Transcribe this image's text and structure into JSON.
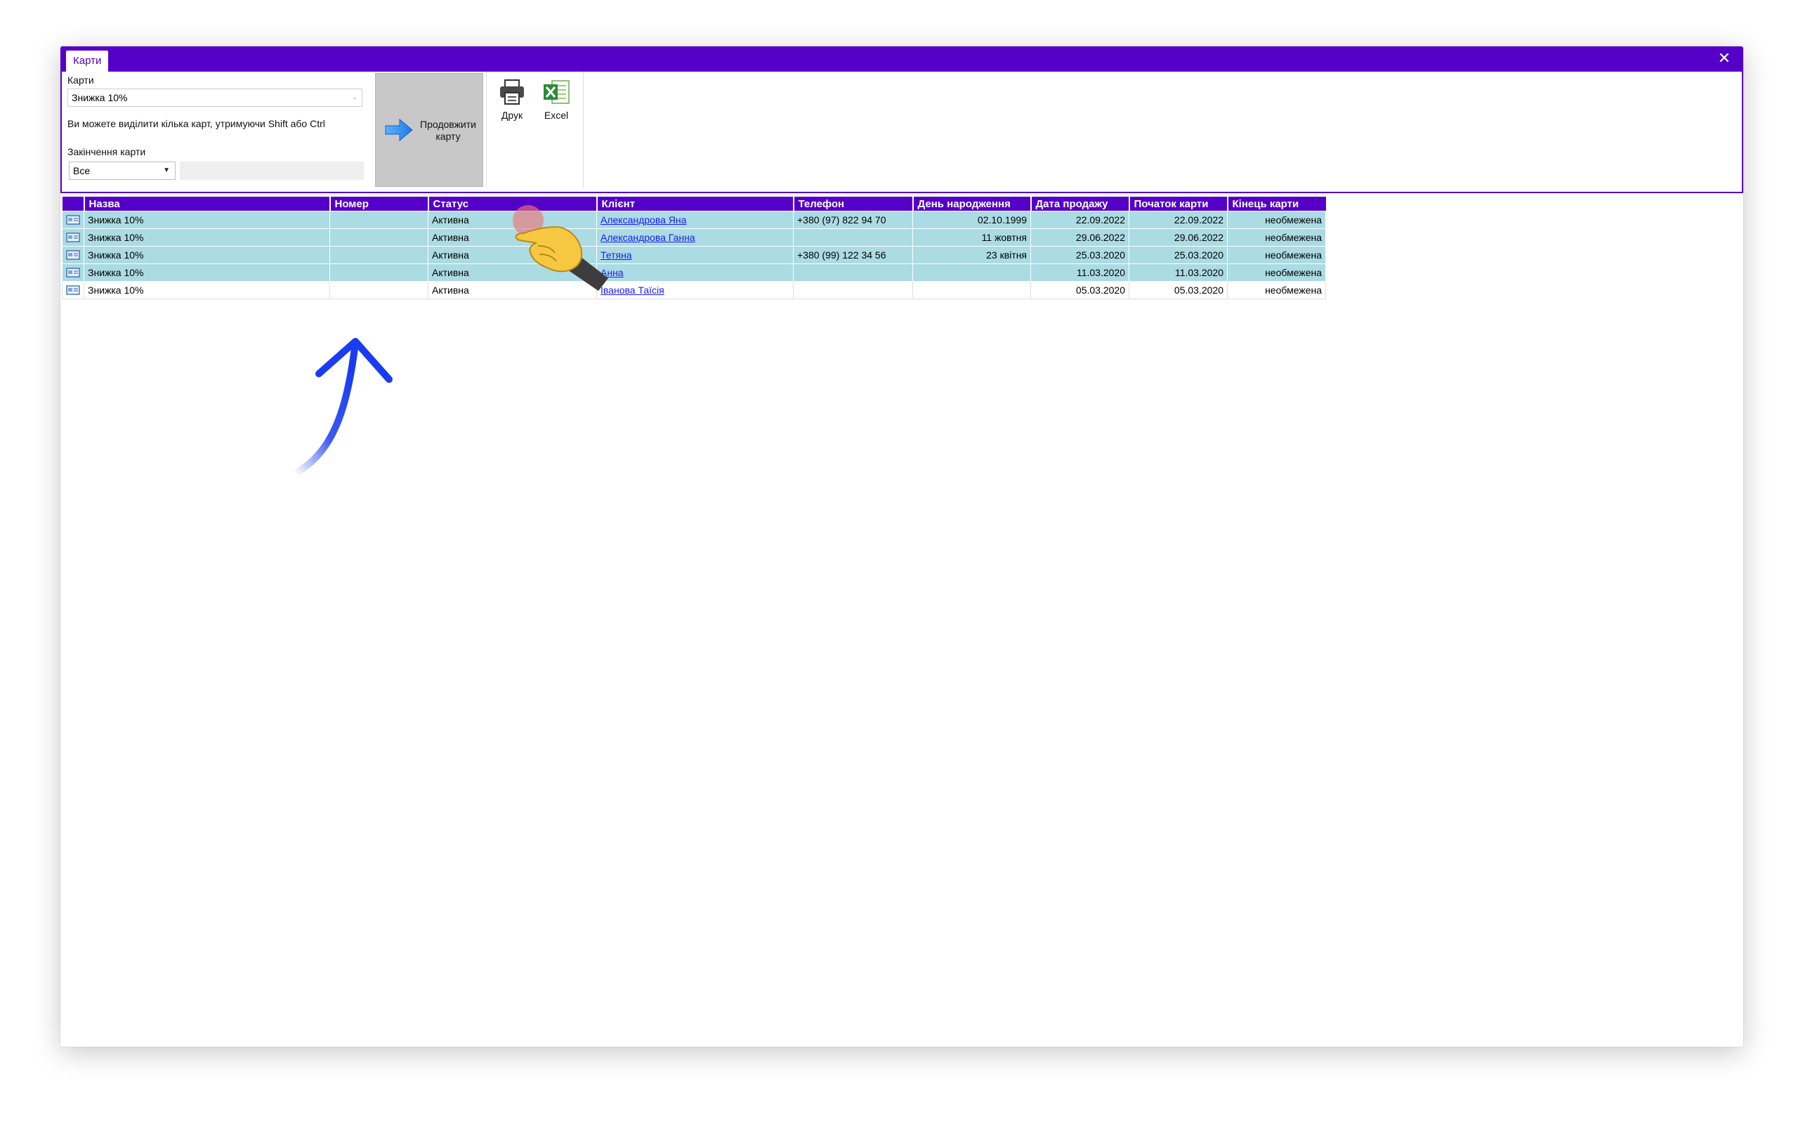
{
  "window": {
    "tab_label": "Карти",
    "close_glyph": "✕"
  },
  "ribbon": {
    "cards_label": "Карти",
    "cards_selected": "Знижка 10%",
    "hint": "Ви можете виділити кілька карт, утримуючи Shift або Ctrl",
    "expiry_label": "Закінчення карти",
    "expiry_selected": "Все",
    "extend_button": "Продовжити карту",
    "print_button": "Друк",
    "excel_button": "Excel"
  },
  "table": {
    "columns": [
      "Назва",
      "Номер",
      "Статус",
      "Клієнт",
      "Телефон",
      "День народження",
      "Дата продажу",
      "Початок карти",
      "Кінець карти"
    ],
    "rows": [
      {
        "name": "Знижка 10%",
        "number": "",
        "status": "Активна",
        "client": "Александрова Яна",
        "phone": "+380 (97) 822 94 70",
        "birthday": "02.10.1999",
        "sale_date": "22.09.2022",
        "start": "22.09.2022",
        "end": "необмежена",
        "selected": true
      },
      {
        "name": "Знижка 10%",
        "number": "",
        "status": "Активна",
        "client": "Александрова Ганна",
        "phone": "",
        "birthday": "11 жовтня",
        "sale_date": "29.06.2022",
        "start": "29.06.2022",
        "end": "необмежена",
        "selected": true
      },
      {
        "name": "Знижка 10%",
        "number": "",
        "status": "Активна",
        "client": "Тетяна",
        "phone": "+380 (99) 122 34 56",
        "birthday": "23 квітня",
        "sale_date": "25.03.2020",
        "start": "25.03.2020",
        "end": "необмежена",
        "selected": true
      },
      {
        "name": "Знижка 10%",
        "number": "",
        "status": "Активна",
        "client": "Анна",
        "phone": "",
        "birthday": "",
        "sale_date": "11.03.2020",
        "start": "11.03.2020",
        "end": "необмежена",
        "selected": true
      },
      {
        "name": "Знижка 10%",
        "number": "",
        "status": "Активна",
        "client": "Іванова Таїсія",
        "phone": "",
        "birthday": "",
        "sale_date": "05.03.2020",
        "start": "05.03.2020",
        "end": "необмежена",
        "selected": false
      }
    ]
  },
  "colors": {
    "accent": "#5500c8",
    "row_selected": "#abdbe3",
    "link": "#1a1aff",
    "annotation_arrow": "#1a3cf0"
  },
  "icons": {
    "close": "close-icon",
    "extend": "arrow-right-icon",
    "print": "printer-icon",
    "excel": "excel-icon",
    "row": "card-icon",
    "pointer": "hand-pointer-icon",
    "annotation": "curved-arrow-up-icon"
  }
}
